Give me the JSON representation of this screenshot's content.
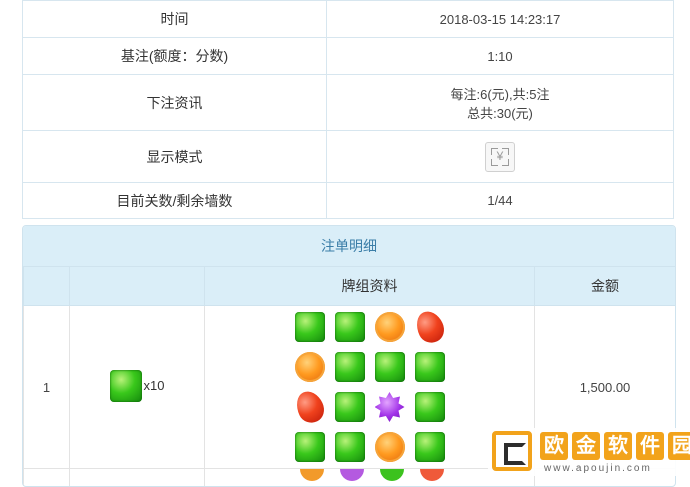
{
  "info": {
    "rows": [
      {
        "label": "时间",
        "value": "2018-03-15 14:23:17"
      },
      {
        "label": "基注(额度：分数)",
        "value": "1:10"
      },
      {
        "label": "下注资讯",
        "value_line1": "每注:6(元),共:5注",
        "value_line2": "总共:30(元)"
      },
      {
        "label": "显示模式",
        "icon": "yuan-mode-icon",
        "icon_glyph": "¥"
      },
      {
        "label": "目前关数/剩余墙数",
        "value": "1/44"
      }
    ],
    "accent_red": "#e03a3a"
  },
  "detail": {
    "title": "注单明细",
    "headers": [
      "",
      "",
      "牌组资料",
      "金额"
    ],
    "rows": [
      {
        "index": "1",
        "bet_symbol": "green-square-candy",
        "bet_multiplier": "x10",
        "board": [
          [
            "green",
            "green",
            "orange",
            "red"
          ],
          [
            "orange",
            "green",
            "green",
            "green"
          ],
          [
            "red",
            "green",
            "purple",
            "green"
          ],
          [
            "green",
            "green",
            "orange",
            "green"
          ]
        ],
        "amount": "1,500.00"
      }
    ]
  },
  "watermark": {
    "chars": [
      "欧",
      "金",
      "软",
      "件",
      "园"
    ],
    "url": "www.apoujin.com"
  }
}
